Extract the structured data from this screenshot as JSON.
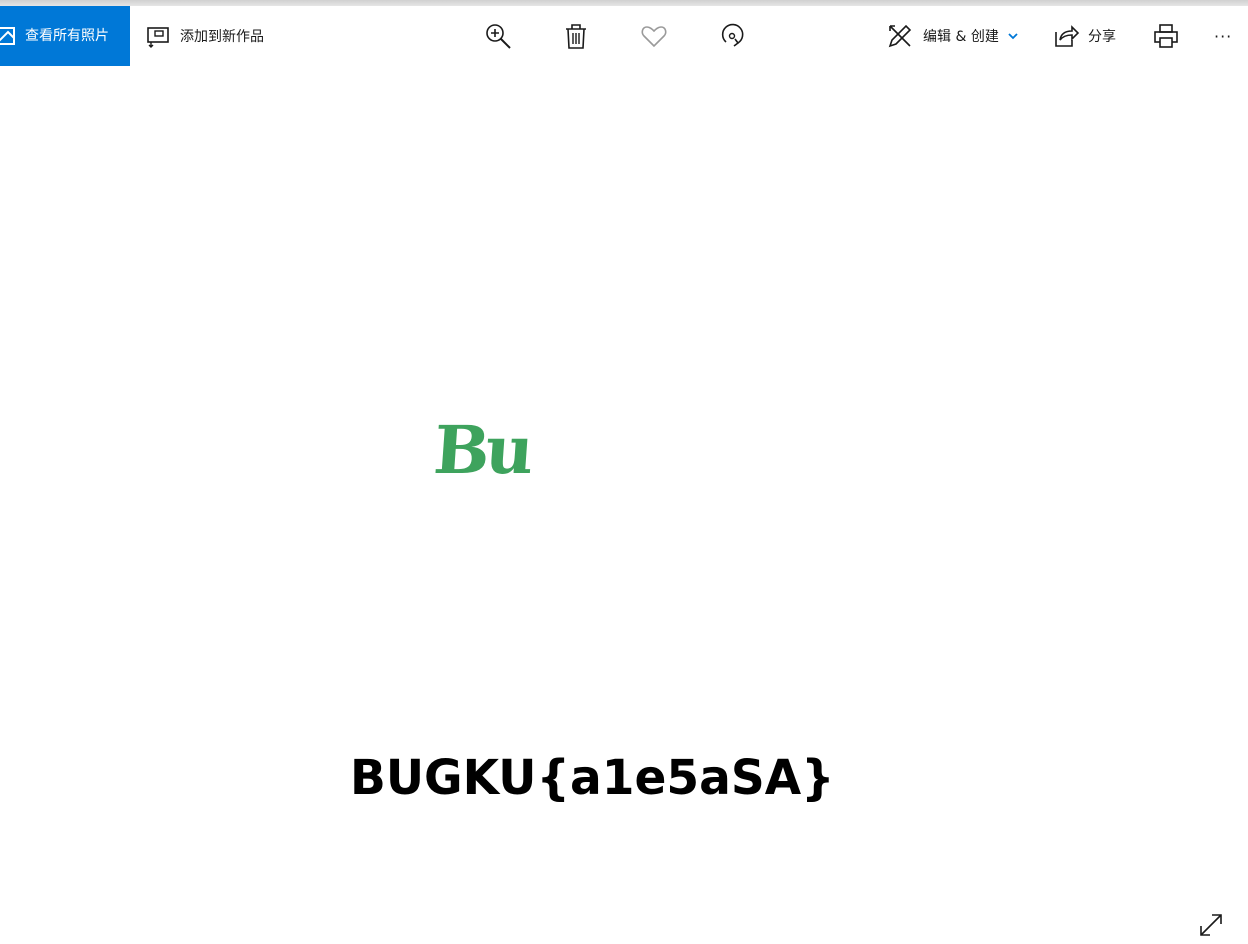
{
  "toolbar": {
    "view_all_photos": "查看所有照片",
    "add_to_creation": "添加到新作品",
    "edit_create": "编辑 & 创建",
    "share": "分享",
    "more": "···"
  },
  "photo": {
    "green_text": "Bu",
    "flag_text": "BUGKU{a1e5aSA}"
  },
  "colors": {
    "accent": "#0078d7",
    "green_text": "#3ea35d",
    "flag_text": "#000000"
  },
  "icons": [
    "photo-icon",
    "add-to-creation-icon",
    "zoom-in-icon",
    "delete-icon",
    "heart-icon",
    "rotate-icon",
    "edit-create-icon",
    "chevron-down-icon",
    "share-icon",
    "print-icon",
    "more-icon",
    "expand-icon"
  ]
}
